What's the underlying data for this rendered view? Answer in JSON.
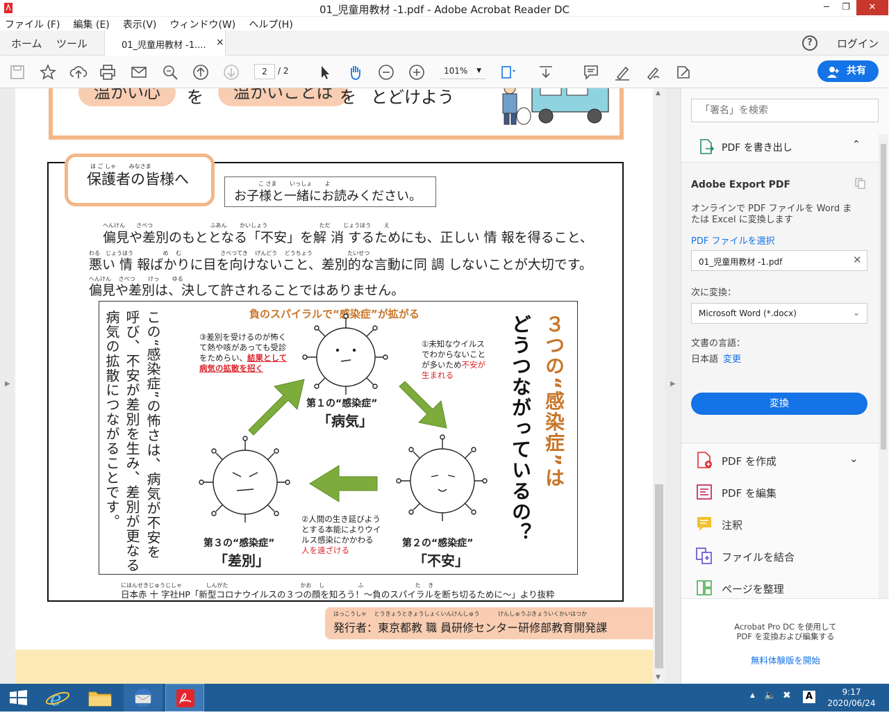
{
  "window": {
    "title": "01_児童用教材 -1.pdf - Adobe Acrobat Reader DC",
    "controls": {
      "minimize": "─",
      "restore": "❐",
      "close": "✕"
    }
  },
  "menu": [
    "ファイル (F)",
    "編集 (E)",
    "表示(V)",
    "ウィンドウ(W)",
    "ヘルプ(H)"
  ],
  "tabs": {
    "home": "ホーム",
    "tools": "ツール",
    "doc": "01_児童用教材 -1....",
    "doc_close": "×",
    "help": "?",
    "login": "ログイン"
  },
  "toolbar": {
    "page_current": "2",
    "page_total": "/ 2",
    "zoom": "101%",
    "share": "共有"
  },
  "document": {
    "banner": {
      "pill1": "温かい心",
      "wo1": "を",
      "pill2": "温かいことば",
      "wo2": "を",
      "end": "とどけよう"
    },
    "guardians_heading": "保護者の皆様へ",
    "guardians_ruby": "ほ ご しゃ　　 みなさま",
    "read_together": "お子様と一緒にお読みください。",
    "read_together_ruby": "こ さま　　 いっしょ　　 よ",
    "para1": "偏見や差別のもととなる「不安」を解 消 するためにも、正しい 情 報を得ること、",
    "para1_ruby": "へんけん　　さべつ　　　　　　　　　　 ふあん　　 かいしょう　　　　　　　　　 ただ　　 じょうほう　　 え",
    "para2": "悪い 情 報ばかりに目を向けないこと、差別的な言動に同 調 しないことが大切です。",
    "para2_ruby": "わる　じょうほう　　　　　 め　 む　　　　　　　さべつてき　 げんどう　 どうちょう　　　　　　 たいせつ",
    "para3": "偏見や差別は、決して許されることではありません。",
    "para3_ruby": "へんけん　 さべつ　　 けっ　　 ゆる",
    "diagram": {
      "title": "負のスパイラルで“感染症”が拡がる",
      "right_title_line1": "３つの“感染症”は",
      "right_title_line2": "どうつながっているの？",
      "left_vertical": [
        "この“感染症”の怖さは、病気が不安を",
        "呼び、不安が差別を生み、差別が更なる",
        "病気の拡散につながることです。"
      ],
      "note3_a": "③差別を受けるのが怖く",
      "note3_b": "て熱や咳があっても受診",
      "note3_c": "をためらい、",
      "note3_red1": "結果として",
      "note3_red2": "病気の拡散を招く",
      "note1_a": "①未知なウイルス",
      "note1_b": "でわからないこと",
      "note1_c": "が多いため",
      "note1_red1": "不安が",
      "note1_red2": "生まれる",
      "note2_a": "②人間の生き延びよう",
      "note2_b": "とする本能によりウイ",
      "note2_c": "ルス感染にかかわる",
      "note2_red": "人を遠ざける",
      "label1": "第１の“感染症”",
      "name1": "「病気」",
      "label2": "第２の“感染症”",
      "name2": "「不安」",
      "label3": "第３の“感染症”",
      "name3": "「差別」"
    },
    "source": "日本赤 十 字社HP「新型コロナウイルスの３つの顔を知ろう！～負のスパイラルを断ち切るために～」より抜粋",
    "source_ruby": "にほんせきじゅうじしゃ　　　　 しんがた　　　　　　　　　　　　　かお　 し　　　　　　ふ　　　　　　　　　 た　 き",
    "publisher": "発行者：東京都教 職 員研修センター研修部教育開発課",
    "publisher_ruby": "はっこうしゃ　 とうきょうときょうしょくいんけんしゅう　　　 けんしゅうぶきょういくかいはつか"
  },
  "rightpane": {
    "search_placeholder": "「署名」を検索",
    "export_header": "PDF を書き出し",
    "adobe_export": "Adobe Export PDF",
    "desc1": "オンラインで PDF ファイルを Word ま",
    "desc2": "たは Excel に変換します",
    "select_pdf": "PDF ファイルを選択",
    "file_name": "01_児童用教材 -1.pdf",
    "convert_to": "次に変換：",
    "format": "Microsoft Word (*.docx)",
    "doc_lang": "文書の言語：",
    "lang": "日本語",
    "change": "変更",
    "convert_btn": "変換",
    "tools": [
      "PDF を作成",
      "PDF を編集",
      "注釈",
      "ファイルを結合",
      "ページを整理"
    ],
    "promo1": "Acrobat Pro DC を使用して",
    "promo2": "PDF を変換および編集する",
    "trial": "無料体験版を開始"
  },
  "taskbar": {
    "time": "9:17",
    "date": "2020/06/24",
    "ime": "A"
  }
}
